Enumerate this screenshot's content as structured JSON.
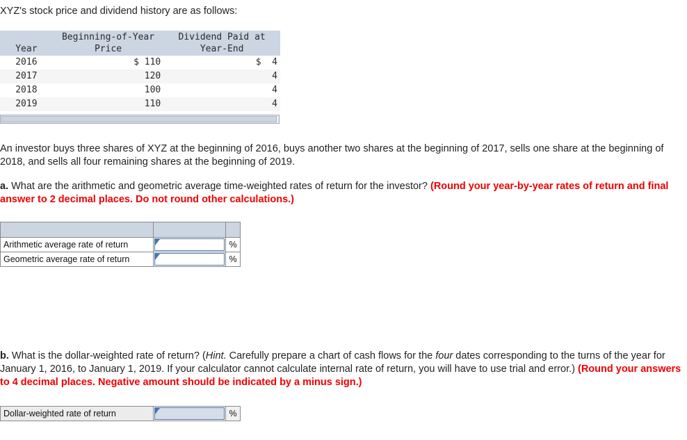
{
  "intro": "XYZ's stock price and dividend history are as follows:",
  "history_table": {
    "headers": {
      "year": "Year",
      "price_line1": "Beginning-of-Year",
      "price_line2": "Price",
      "dividend_line1": "Dividend Paid at",
      "dividend_line2": "Year-End"
    },
    "rows": [
      {
        "year": "2016",
        "price": "$ 110",
        "dividend": "$  4"
      },
      {
        "year": "2017",
        "price": "120",
        "dividend": "4"
      },
      {
        "year": "2018",
        "price": "100",
        "dividend": "4"
      },
      {
        "year": "2019",
        "price": "110",
        "dividend": "4"
      }
    ]
  },
  "investor_paragraph": "An investor buys three shares of XYZ at the beginning of 2016, buys another two shares at the beginning of 2017, sells one share at the beginning of 2018, and sells all four remaining shares at the beginning of 2019.",
  "question_a": {
    "label": "a.",
    "text": " What are the arithmetic and geometric average time-weighted rates of return for the investor? ",
    "instruction": "(Round your year-by-year rates of return and final answer to 2 decimal places. Do not round other calculations.)",
    "rows": [
      {
        "label": "Arithmetic average rate of return",
        "value": "",
        "unit": "%"
      },
      {
        "label": "Geometric average rate of return",
        "value": "",
        "unit": "%"
      }
    ]
  },
  "question_b": {
    "label": "b.",
    "text_1": " What is the dollar-weighted rate of return? (",
    "hint_word": "Hint.",
    "text_2": " Carefully prepare a chart of cash flows for the ",
    "four_word": "four",
    "text_3": " dates corresponding to the turns of the year for January 1, 2016, to January 1, 2019. If your calculator cannot calculate internal rate of return, you will have to use trial and error.) ",
    "instruction": "(Round your answers to 4 decimal places. Negative amount should be indicated by a minus sign.)",
    "rows": [
      {
        "label": "Dollar-weighted rate of return",
        "value": "",
        "unit": "%"
      }
    ]
  },
  "colors": {
    "header_fill": "#ccd5e2",
    "stripe": "#f5f5f5",
    "red_instruction": "#ee0000",
    "entry_border": "#4878b0",
    "entry_filled": "#d6dce8"
  }
}
